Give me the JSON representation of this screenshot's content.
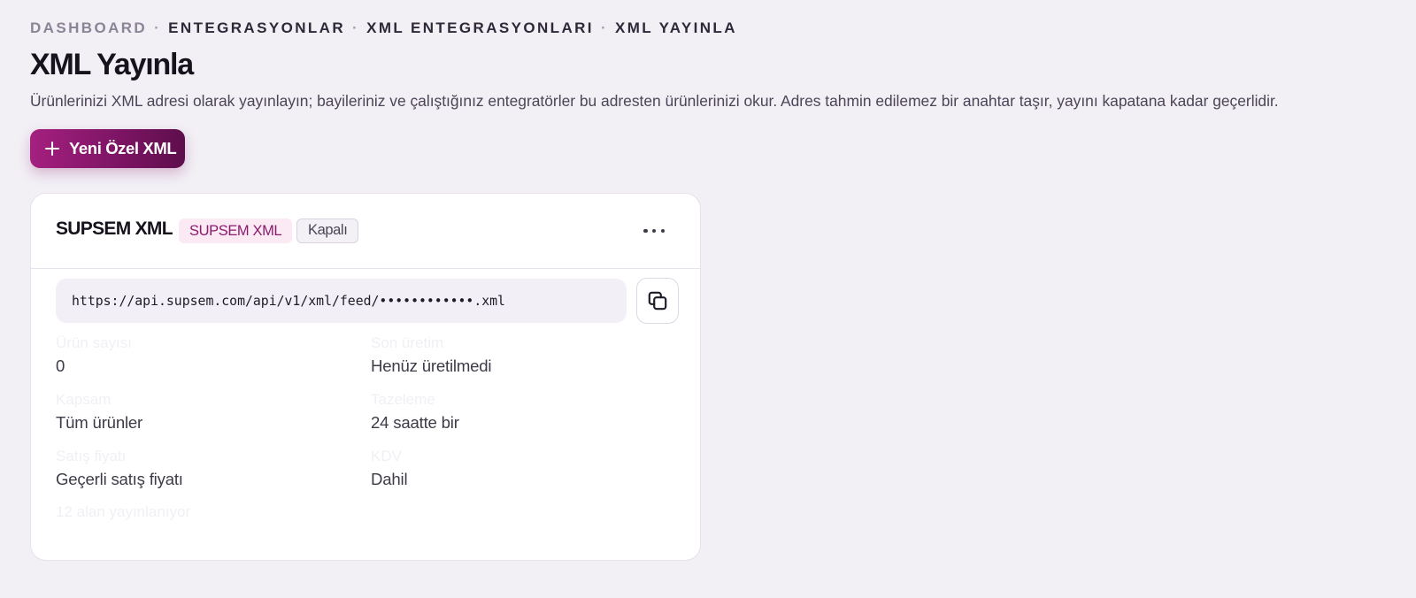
{
  "breadcrumb": {
    "items": [
      "DASHBOARD",
      "ENTEGRASYONLAR",
      "XML ENTEGRASYONLARI",
      "XML YAYINLA"
    ],
    "separator": "·"
  },
  "page": {
    "title": "XML Yayınla",
    "description": "Ürünlerinizi XML adresi olarak yayınlayın; bayileriniz ve çalıştığınız entegratörler bu adresten ürünlerinizi okur. Adres tahmin edilemez bir anahtar taşır, yayını kapatana kadar geçerlidir."
  },
  "actions": {
    "new_xml_label": "Yeni Özel XML",
    "new_xml_icon": "plus-icon"
  },
  "card": {
    "title": "SUPSEM XML",
    "tag": "SUPSEM XML",
    "status": "Kapalı",
    "more_icon": "more-horizontal-icon",
    "url": "https://api.supsem.com/api/v1/xml/feed/••••••••••••.xml",
    "copy_icon": "copy-icon",
    "fields": [
      {
        "label": "Ürün sayısı",
        "value": "0"
      },
      {
        "label": "Son üretim",
        "value": "Henüz üretilmedi"
      },
      {
        "label": "Kapsam",
        "value": "Tüm ürünler"
      },
      {
        "label": "Tazeleme",
        "value": "24 saatte bir"
      },
      {
        "label": "Satış fiyatı",
        "value": "Geçerli satış fiyatı"
      },
      {
        "label": "KDV",
        "value": "Dahil"
      }
    ],
    "footer": "12 alan yayınlanıyor"
  },
  "colors": {
    "background": "#f2eff5",
    "accent": "#8a1b6c",
    "accent_gradient_start": "#a4207f",
    "accent_gradient_end": "#5e0e4c",
    "tag_background": "#fbe9f4"
  }
}
